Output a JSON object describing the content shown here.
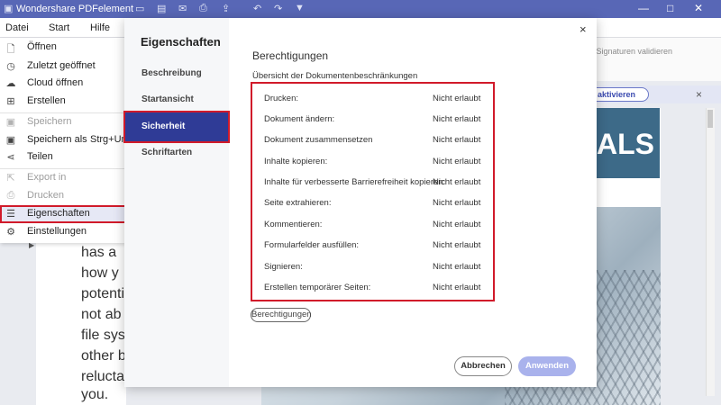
{
  "app": {
    "title": "Wondershare PDFelement"
  },
  "menubar": {
    "items": [
      "Datei",
      "Start",
      "Hilfe"
    ]
  },
  "file_menu": {
    "items": [
      {
        "label": "Öffnen",
        "icon": "file-open-icon",
        "glyph": "🗋",
        "disabled": false
      },
      {
        "label": "Zuletzt geöffnet",
        "icon": "clock-icon",
        "glyph": "◷",
        "disabled": false
      },
      {
        "label": "Cloud öffnen",
        "icon": "cloud-icon",
        "glyph": "☁",
        "disabled": false
      },
      {
        "label": "Erstellen",
        "icon": "plus-icon",
        "glyph": "⊞",
        "disabled": false
      },
      {
        "label": "Speichern",
        "icon": "save-icon",
        "glyph": "▣",
        "disabled": true
      },
      {
        "label": "Speichern als",
        "shortcut": "Strg+Um",
        "icon": "save-as-icon",
        "glyph": "▣",
        "disabled": false
      },
      {
        "label": "Teilen",
        "icon": "share-icon",
        "glyph": "⋖",
        "disabled": false
      },
      {
        "label": "Export in",
        "icon": "export-icon",
        "glyph": "⇱",
        "disabled": true
      },
      {
        "label": "Drucken",
        "icon": "print-icon",
        "glyph": "⎙",
        "disabled": true
      },
      {
        "label": "Eigenschaften",
        "icon": "properties-icon",
        "glyph": "☰",
        "disabled": false,
        "selected": true
      },
      {
        "label": "Einstellungen",
        "icon": "settings-icon",
        "glyph": "⚙",
        "disabled": false
      }
    ]
  },
  "toolbar_right": {
    "validate_label": "lle Signaturen validieren"
  },
  "notice": {
    "button_label": "g aktivieren"
  },
  "document": {
    "lines": [
      "has a",
      "how y",
      "potenti",
      "not ab",
      "file syst",
      "other b",
      "reluctar",
      "you."
    ],
    "banner_text": "ALS"
  },
  "modal": {
    "sidebar_title": "Eigenschaften",
    "sidebar_items": [
      {
        "label": "Beschreibung",
        "active": false
      },
      {
        "label": "Startansicht",
        "active": false
      },
      {
        "label": "Sicherheit",
        "active": true
      },
      {
        "label": "Schriftarten",
        "active": false
      }
    ],
    "close_glyph": "×",
    "section_title": "Berechtigungen",
    "section_subtitle": "Übersicht der Dokumentenbeschränkungen",
    "permissions": [
      {
        "name": "Drucken:",
        "value": "Nicht erlaubt"
      },
      {
        "name": "Dokument ändern:",
        "value": "Nicht erlaubt"
      },
      {
        "name": "Dokument zusammensetzen",
        "value": "Nicht erlaubt"
      },
      {
        "name": "Inhalte kopieren:",
        "value": "Nicht erlaubt"
      },
      {
        "name": "Inhalte für verbesserte Barrierefreiheit kopieren:",
        "value": "Nicht erlaubt"
      },
      {
        "name": "Seite extrahieren:",
        "value": "Nicht erlaubt"
      },
      {
        "name": "Kommentieren:",
        "value": "Nicht erlaubt"
      },
      {
        "name": "Formularfelder ausfüllen:",
        "value": "Nicht erlaubt"
      },
      {
        "name": "Signieren:",
        "value": "Nicht erlaubt"
      },
      {
        "name": "Erstellen temporärer Seiten:",
        "value": "Nicht erlaubt"
      }
    ],
    "permissions_button": "Berechtigungen",
    "cancel_label": "Abbrechen",
    "apply_label": "Anwenden"
  },
  "colors": {
    "titlebar": "#5867b6",
    "active_nav": "#2f3b96",
    "highlight": "#d11a2a",
    "apply_button": "#a9b2ec"
  }
}
